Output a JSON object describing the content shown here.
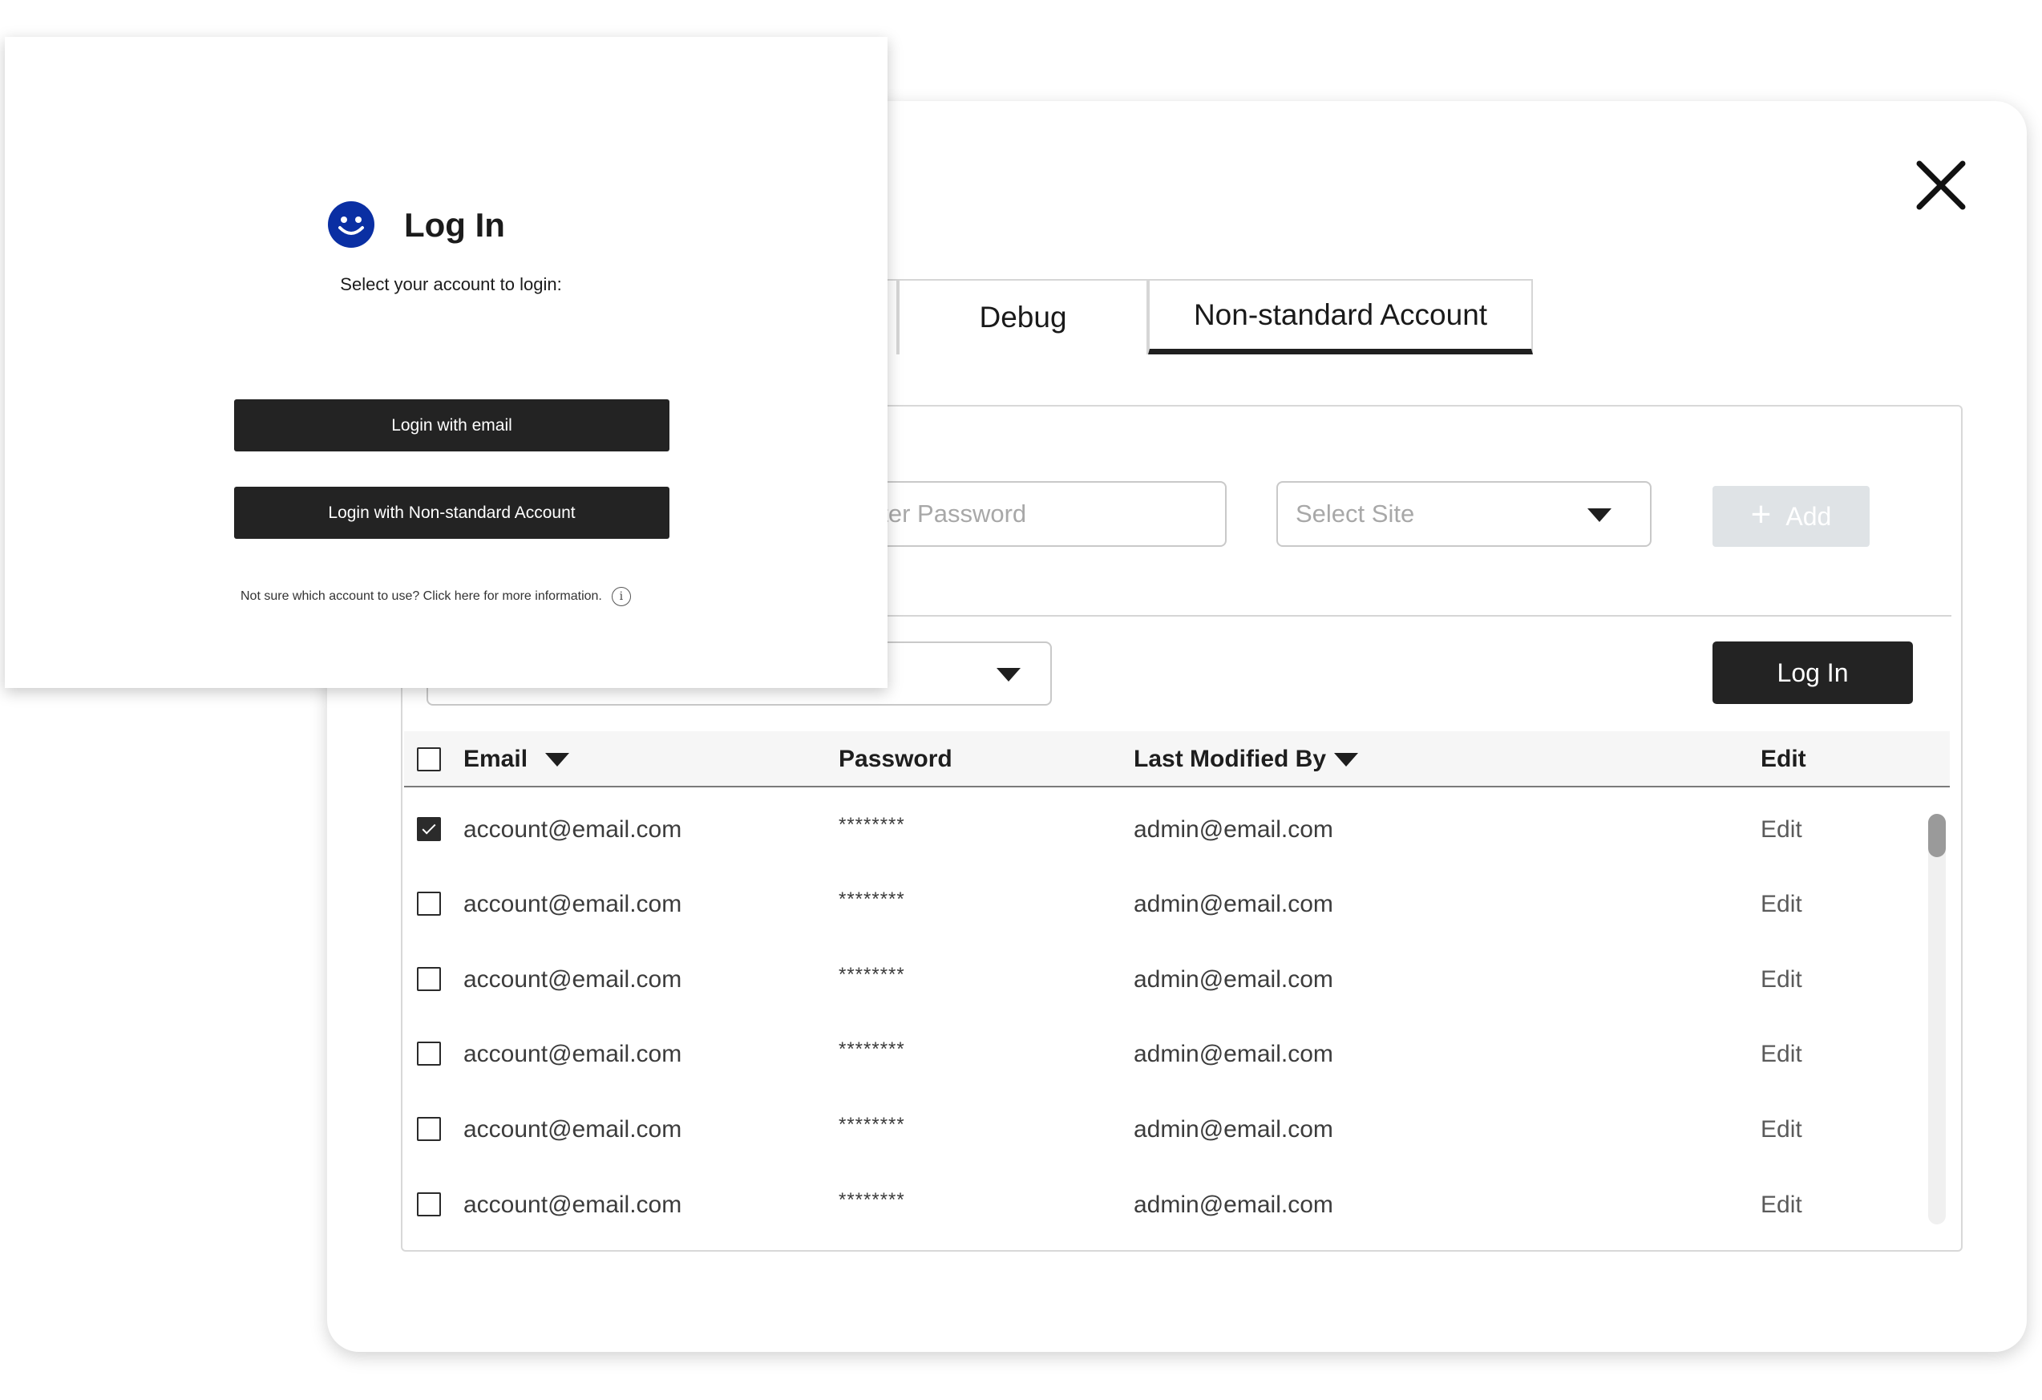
{
  "login_card": {
    "title": "Log In",
    "subtitle": "Select your account to login:",
    "login_email_label": "Login with email",
    "login_nonstandard_label": "Login with Non-standard Account",
    "help_text": "Not sure which account to use? Click here for more information.",
    "help_icon_glyph": "i",
    "logo_color": "#0a2fa3"
  },
  "manager": {
    "tabs": [
      {
        "label": ""
      },
      {
        "label": "Debug"
      },
      {
        "label": "Non-standard Account",
        "active": true
      }
    ],
    "password_placeholder": "Enter Password",
    "password_visible_text": "nter Password",
    "site_placeholder": "Select Site",
    "add_label": "Add",
    "add_icon": "+",
    "login_label": "Log In",
    "table": {
      "columns": [
        "Email",
        "Password",
        "Last Modified By",
        "Edit"
      ],
      "rows": [
        {
          "checked": true,
          "email": "account@email.com",
          "password": "********",
          "modified_by": "admin@email.com",
          "edit": "Edit"
        },
        {
          "checked": false,
          "email": "account@email.com",
          "password": "********",
          "modified_by": "admin@email.com",
          "edit": "Edit"
        },
        {
          "checked": false,
          "email": "account@email.com",
          "password": "********",
          "modified_by": "admin@email.com",
          "edit": "Edit"
        },
        {
          "checked": false,
          "email": "account@email.com",
          "password": "********",
          "modified_by": "admin@email.com",
          "edit": "Edit"
        },
        {
          "checked": false,
          "email": "account@email.com",
          "password": "********",
          "modified_by": "admin@email.com",
          "edit": "Edit"
        },
        {
          "checked": false,
          "email": "account@email.com",
          "password": "********",
          "modified_by": "admin@email.com",
          "edit": "Edit"
        }
      ]
    },
    "colors": {
      "primary_button": "#232323",
      "disabled_button": "#dfe3e6"
    }
  }
}
